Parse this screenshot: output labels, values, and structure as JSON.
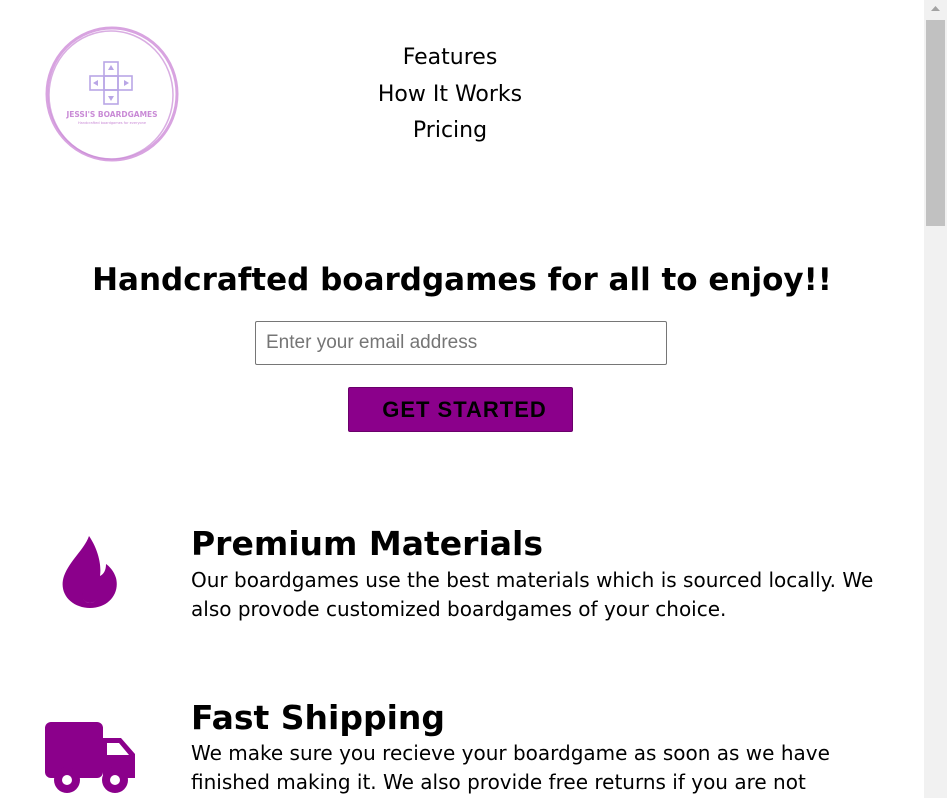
{
  "brand": {
    "logo_text": "JESSI'S BOARDGAMES",
    "logo_tagline": "Handcrafted boardgames for everyone",
    "accent_color": "#8b008b",
    "logo_color": "#c98ad6"
  },
  "nav": {
    "items": [
      {
        "label": "Features"
      },
      {
        "label": "How It Works"
      },
      {
        "label": "Pricing"
      }
    ]
  },
  "hero": {
    "title": "Handcrafted boardgames for all to enjoy!!",
    "email_placeholder": "Enter your email address",
    "email_value": "",
    "cta_label": "GET STARTED"
  },
  "features": [
    {
      "icon": "fire-icon",
      "title": "Premium Materials",
      "text": "Our boardgames use the best materials which is sourced locally. We also provode customized boardgames of your choice."
    },
    {
      "icon": "truck-icon",
      "title": "Fast Shipping",
      "text": "We make sure you recieve your boardgame as soon as we have finished making it. We also provide free returns if you are not"
    }
  ]
}
